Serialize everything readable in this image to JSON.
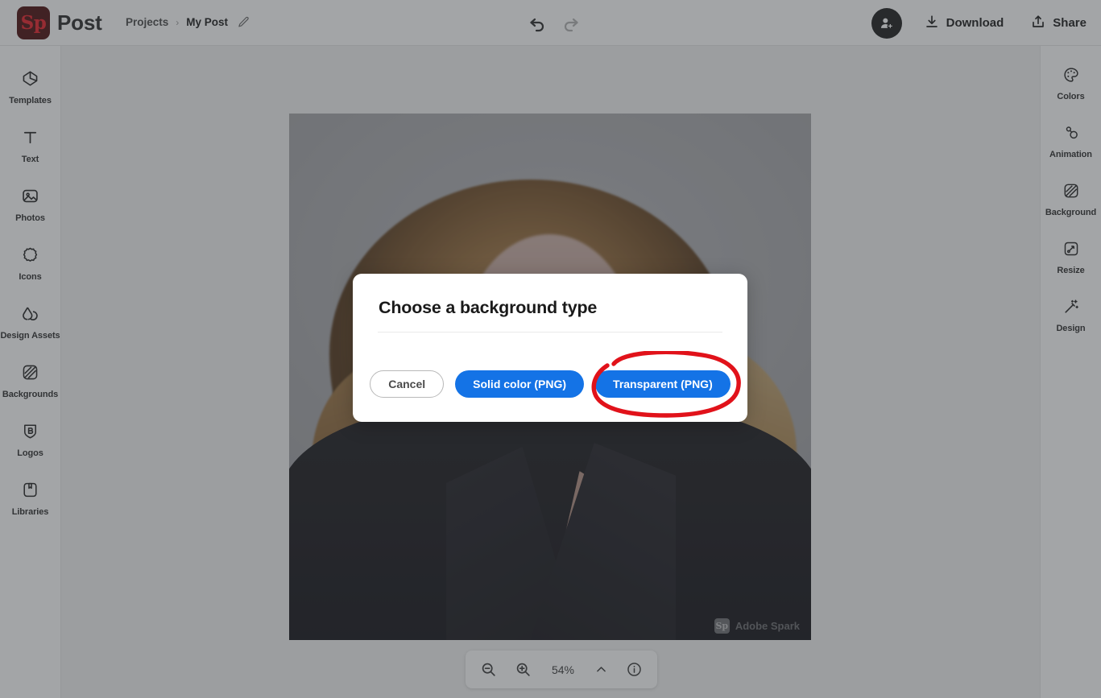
{
  "app": {
    "brand_mark": "Sp",
    "brand_name": "Post",
    "accent_blue": "#1473e6",
    "annotation_red": "#e1121a",
    "logo_bg": "#4b0d0d"
  },
  "header": {
    "breadcrumb": {
      "root": "Projects",
      "separator": "›",
      "current": "My Post",
      "edit_icon": "pencil-icon"
    },
    "history": {
      "undo": "undo-icon",
      "redo": "redo-icon",
      "undo_enabled": true,
      "redo_enabled": false
    },
    "avatar_icon": "add-collaborator-icon",
    "download_label": "Download",
    "download_icon": "download-icon",
    "share_label": "Share",
    "share_icon": "share-icon"
  },
  "left_rail": {
    "items": [
      {
        "label": "Templates",
        "icon": "templates-icon"
      },
      {
        "label": "Text",
        "icon": "text-icon"
      },
      {
        "label": "Photos",
        "icon": "photos-icon"
      },
      {
        "label": "Icons",
        "icon": "icons-icon"
      },
      {
        "label": "Design Assets",
        "icon": "design-assets-icon"
      },
      {
        "label": "Backgrounds",
        "icon": "backgrounds-icon"
      },
      {
        "label": "Logos",
        "icon": "logos-icon"
      },
      {
        "label": "Libraries",
        "icon": "libraries-icon"
      }
    ]
  },
  "right_rail": {
    "items": [
      {
        "label": "Colors",
        "icon": "palette-icon"
      },
      {
        "label": "Animation",
        "icon": "animation-icon"
      },
      {
        "label": "Background",
        "icon": "background-icon"
      },
      {
        "label": "Resize",
        "icon": "resize-icon"
      },
      {
        "label": "Design",
        "icon": "magic-wand-icon"
      }
    ]
  },
  "canvas": {
    "watermark_mark": "Sp",
    "watermark_text": "Adobe Spark"
  },
  "zoom_toolbar": {
    "zoom_out_icon": "zoom-out-icon",
    "zoom_in_icon": "zoom-in-icon",
    "zoom_level": "54%",
    "chevron_icon": "chevron-up-icon",
    "info_icon": "info-icon"
  },
  "modal": {
    "title": "Choose a background type",
    "cancel_label": "Cancel",
    "solid_label": "Solid color (PNG)",
    "transparent_label": "Transparent (PNG)",
    "highlighted_button": "Transparent (PNG)"
  }
}
